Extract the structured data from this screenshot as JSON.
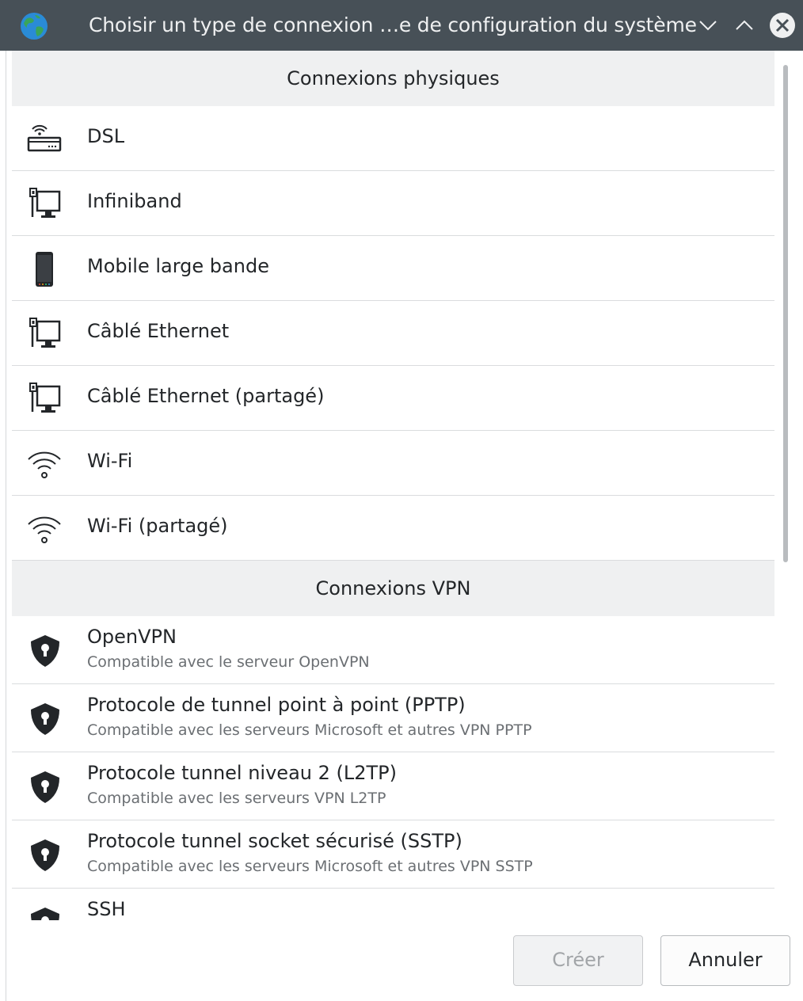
{
  "window": {
    "title": "Choisir un type de connexion …e de configuration du système"
  },
  "sections": [
    {
      "header": "Connexions physiques",
      "items": [
        {
          "label": "DSL",
          "icon": "dsl-modem-icon"
        },
        {
          "label": "Infiniband",
          "icon": "wired-network-icon"
        },
        {
          "label": "Mobile large bande",
          "icon": "mobile-phone-icon"
        },
        {
          "label": "Câblé Ethernet",
          "icon": "wired-network-icon"
        },
        {
          "label": "Câblé Ethernet (partagé)",
          "icon": "wired-network-icon"
        },
        {
          "label": "Wi-Fi",
          "icon": "wifi-icon"
        },
        {
          "label": "Wi-Fi (partagé)",
          "icon": "wifi-icon"
        }
      ]
    },
    {
      "header": "Connexions VPN",
      "items": [
        {
          "label": "OpenVPN",
          "desc": "Compatible avec le serveur OpenVPN",
          "icon": "vpn-shield-icon"
        },
        {
          "label": "Protocole de tunnel point à point (PPTP)",
          "desc": "Compatible avec les serveurs Microsoft et autres VPN PPTP",
          "icon": "vpn-shield-icon"
        },
        {
          "label": "Protocole tunnel niveau 2 (L2TP)",
          "desc": "Compatible avec les serveurs VPN L2TP",
          "icon": "vpn-shield-icon"
        },
        {
          "label": "Protocole tunnel socket sécurisé (SSTP)",
          "desc": "Compatible avec les serveurs Microsoft et autres VPN SSTP",
          "icon": "vpn-shield-icon"
        },
        {
          "label": "SSH",
          "desc": "",
          "icon": "vpn-shield-icon"
        }
      ]
    }
  ],
  "buttons": {
    "create": "Créer",
    "cancel": "Annuler"
  },
  "colors": {
    "titlebar": "#475057",
    "section_header_bg": "#eff0f1",
    "separator": "#dadcde"
  }
}
